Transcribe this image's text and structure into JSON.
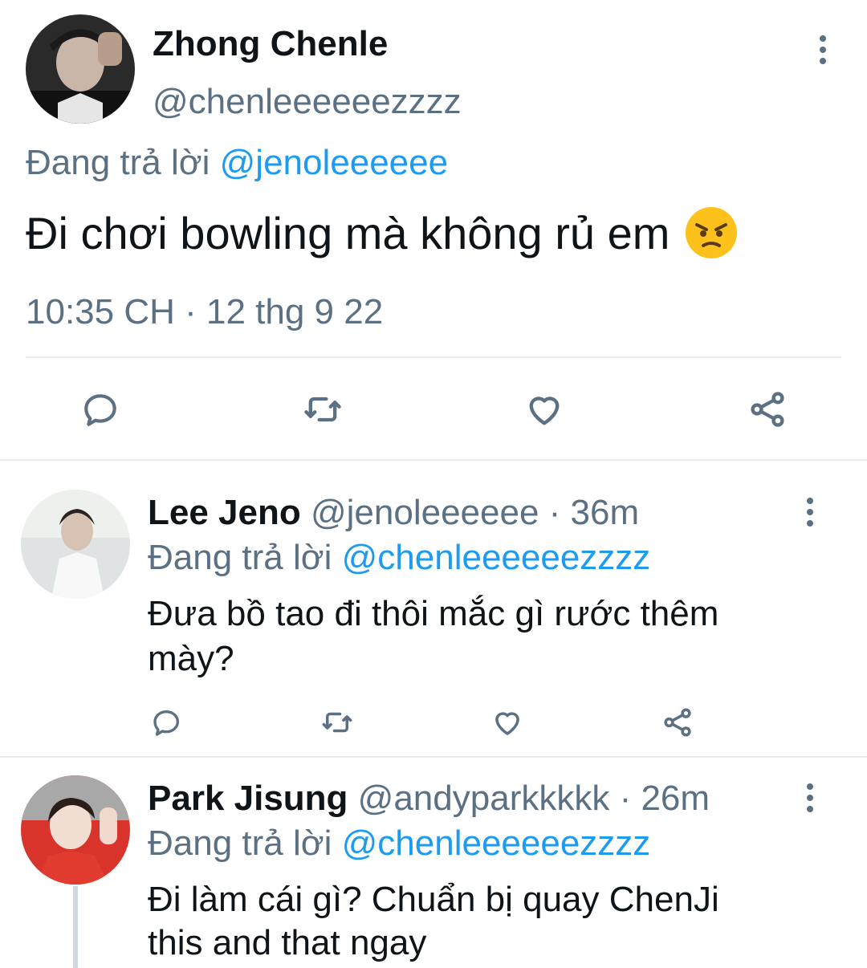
{
  "main_tweet": {
    "author_name": "Zhong Chenle",
    "handle": "@chenleeeeeezzzz",
    "replying_prefix": "Đang trả lời",
    "replying_to": "@jenoleeeeee",
    "text": "Đi chơi bowling mà không rủ em",
    "emoji": "angry-face",
    "timestamp": "10:35 CH · 12 thg 9 22",
    "avatar_icon": "avatar-photo-chenle"
  },
  "actions": [
    "reply-icon",
    "retweet-icon",
    "like-icon",
    "share-icon"
  ],
  "replies": [
    {
      "author_name": "Lee Jeno",
      "handle": "@jenoleeeeee",
      "time": "· 36m",
      "replying_prefix": "Đang trả lời",
      "replying_to": "@chenleeeeeezzzz",
      "text_line1": "Đưa bồ tao đi thôi mắc gì rước thêm",
      "text_line2": "mày?"
    },
    {
      "author_name": "Park Jisung",
      "handle": "@andyparkkkkk",
      "time": "· 26m",
      "replying_prefix": "Đang trả lời",
      "replying_to": "@chenleeeeeezzzz",
      "text_line1": "Đi làm cái gì? Chuẩn bị quay ChenJi",
      "text_line2": "this and that ngay"
    }
  ],
  "colors": {
    "link": "#1d9bf0",
    "muted": "#5b7083",
    "divider": "#e6ecf0"
  }
}
